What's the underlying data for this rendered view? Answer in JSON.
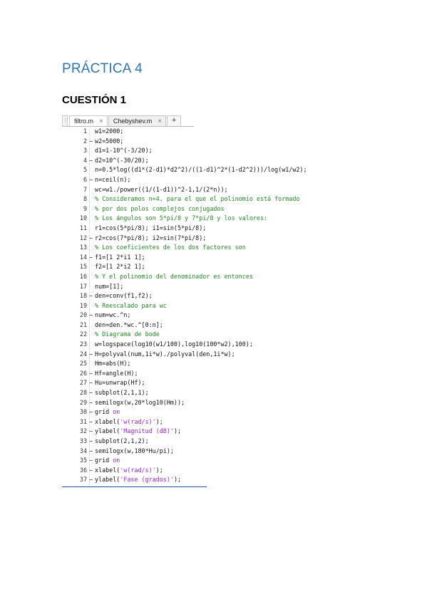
{
  "document": {
    "title": "PRÁCTICA 4",
    "subtitle": "CUESTIÓN 1"
  },
  "editor": {
    "tabs": [
      {
        "label": "filtro.m",
        "close": "×",
        "active": true
      },
      {
        "label": "Chebyshev.m",
        "close": "×",
        "active": false
      }
    ],
    "add_tab": "+",
    "lines": [
      {
        "n": "1",
        "mark": "",
        "text": "w1=2000;",
        "kind": "code"
      },
      {
        "n": "2",
        "mark": "−",
        "text": "w2=5000;",
        "kind": "code"
      },
      {
        "n": "3",
        "mark": "",
        "text": "d1=1-10^(-3/20);",
        "kind": "code"
      },
      {
        "n": "4",
        "mark": "−",
        "text": "d2=10^(-30/20);",
        "kind": "code"
      },
      {
        "n": "5",
        "mark": "",
        "text": "n=0.5*log((d1*(2-d1)*d2^2)/((1-d1)^2*(1-d2^2)))/log(w1/w2);",
        "kind": "code"
      },
      {
        "n": "6",
        "mark": "−",
        "text": "n=ceil(n);",
        "kind": "code"
      },
      {
        "n": "7",
        "mark": "",
        "text": "wc=w1./power((1/(1-d1))^2-1,1/(2*n));",
        "kind": "code"
      },
      {
        "n": "8",
        "mark": "",
        "text": "% Consideramos n=4, para el que el polinomio está formado",
        "kind": "comment"
      },
      {
        "n": "9",
        "mark": "",
        "text": "% por dos polos complejos conjugados",
        "kind": "comment"
      },
      {
        "n": "10",
        "mark": "",
        "text": "% Los ángulos son 5*pi/8 y 7*pi/8 y los valores:",
        "kind": "comment"
      },
      {
        "n": "11",
        "mark": "",
        "text": "r1=cos(5*pi/8); i1=sin(5*pi/8);",
        "kind": "code"
      },
      {
        "n": "12",
        "mark": "−",
        "text": "r2=cos(7*pi/8); i2=sin(7*pi/8);",
        "kind": "code"
      },
      {
        "n": "13",
        "mark": "",
        "text": "% Los coeficientes de los dos factores son",
        "kind": "comment"
      },
      {
        "n": "14",
        "mark": "−",
        "text": "f1=[1 2*i1 1];",
        "kind": "code"
      },
      {
        "n": "15",
        "mark": "",
        "text": "f2=[1 2*i2 1];",
        "kind": "code"
      },
      {
        "n": "16",
        "mark": "",
        "text": "% Y el polinomio del denominador es entonces",
        "kind": "comment"
      },
      {
        "n": "17",
        "mark": "",
        "text": "num=[1];",
        "kind": "code"
      },
      {
        "n": "18",
        "mark": "−",
        "text": "den=conv(f1,f2);",
        "kind": "code"
      },
      {
        "n": "19",
        "mark": "",
        "text": "% Reescalado para wc",
        "kind": "comment"
      },
      {
        "n": "20",
        "mark": "−",
        "text": "num=wc.^n;",
        "kind": "code"
      },
      {
        "n": "21",
        "mark": "",
        "text": "den=den.*wc.^[0:n];",
        "kind": "code"
      },
      {
        "n": "22",
        "mark": "",
        "text": "% Diagrama de bode",
        "kind": "comment"
      },
      {
        "n": "23",
        "mark": "",
        "text": "w=logspace(log10(w1/100),log10(100*w2),100);",
        "kind": "code"
      },
      {
        "n": "24",
        "mark": "−",
        "text": "H=polyval(num,1i*w)./polyval(den,1i*w);",
        "kind": "code"
      },
      {
        "n": "25",
        "mark": "",
        "text": "Hm=abs(H);",
        "kind": "code"
      },
      {
        "n": "26",
        "mark": "−",
        "text": "Hf=angle(H);",
        "kind": "code"
      },
      {
        "n": "27",
        "mark": "−",
        "text": "Hu=unwrap(Hf);",
        "kind": "code"
      },
      {
        "n": "28",
        "mark": "−",
        "text": "subplot(2,1,1);",
        "kind": "code"
      },
      {
        "n": "29",
        "mark": "−",
        "text": "semilogx(w,20*log10(Hm));",
        "kind": "code"
      },
      {
        "n": "30",
        "mark": "−",
        "text": "grid on",
        "kind": "grid"
      },
      {
        "n": "31",
        "mark": "−",
        "text": "xlabel('w(rad/s)');",
        "kind": "str"
      },
      {
        "n": "32",
        "mark": "−",
        "text": "ylabel('Magnitud (dB)');",
        "kind": "str"
      },
      {
        "n": "33",
        "mark": "−",
        "text": "subplot(2,1,2);",
        "kind": "code"
      },
      {
        "n": "34",
        "mark": "−",
        "text": "semilogx(w,180*Hu/pi);",
        "kind": "code"
      },
      {
        "n": "35",
        "mark": "−",
        "text": "grid on",
        "kind": "grid"
      },
      {
        "n": "36",
        "mark": "−",
        "text": "xlabel('w(rad/s)');",
        "kind": "str"
      },
      {
        "n": "37",
        "mark": "−",
        "text": "ylabel('Fase (grados)');",
        "kind": "str"
      }
    ]
  }
}
